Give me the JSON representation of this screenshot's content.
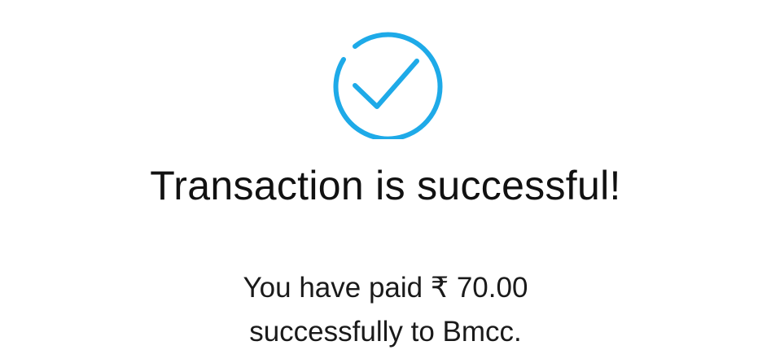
{
  "colors": {
    "accent": "#1eaae8",
    "text": "#111111",
    "background": "#ffffff"
  },
  "icon": "check-circle-icon",
  "title": "Transaction is successful!",
  "message": {
    "line1": "You have paid ₹ 70.00",
    "line2": "successfully to Bmcc."
  }
}
